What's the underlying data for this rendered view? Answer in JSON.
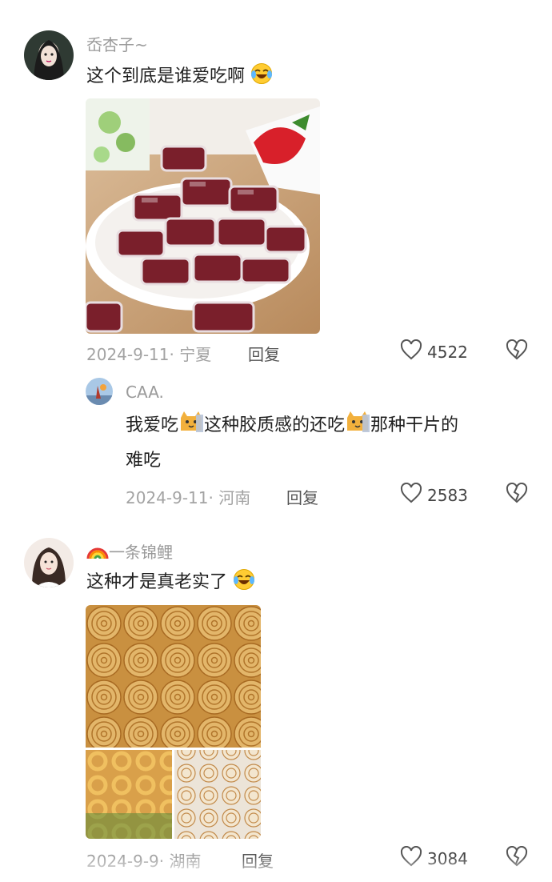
{
  "comments": [
    {
      "username": "岙杏子~",
      "text": "这个到底是谁爱吃啊",
      "emoji": "laughing-tears-icon",
      "image": "bowl of wrapped red dried fruit candies with strawberry",
      "date": "2024-9-11",
      "location": "宁夏",
      "reply_label": "回复",
      "likes": "4522",
      "reply": {
        "username": "CAA.",
        "text_part1": "我爱吃",
        "text_part2": "这种胶质感的还吃",
        "text_part3": "那种干片的",
        "text_line2": "难吃",
        "date": "2024-9-11",
        "location": "河南",
        "reply_label": "回复",
        "likes": "2583"
      }
    },
    {
      "username": "一条锦鲤",
      "username_prefix_icon": "rainbow-icon",
      "text": "这种才是真老实了",
      "emoji": "laughing-tears-icon",
      "image": "spiral dried fruit roll slices and fruit rings collage",
      "date": "2024-9-9",
      "location": "湖南",
      "reply_label": "回复",
      "likes": "3084"
    }
  ],
  "colors": {
    "meta_gray": "#a3a3a3",
    "text": "#1f1f1f",
    "candy_red": "#7a1f2b",
    "swirl_tan": "#d9a85a"
  }
}
